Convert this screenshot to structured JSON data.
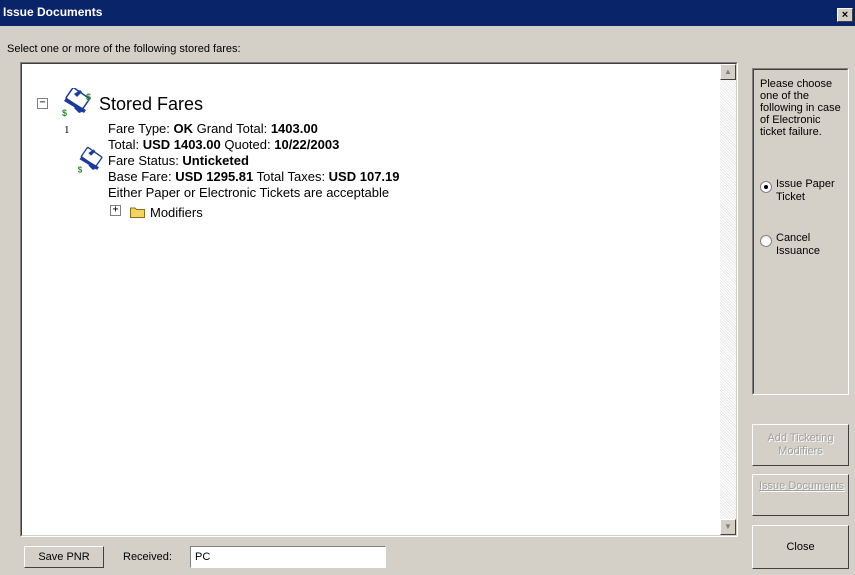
{
  "window": {
    "title": "Issue Documents",
    "close_glyph": "×"
  },
  "prompt_text": "Select one or more of the following stored fares:",
  "tree": {
    "root_expander": "−",
    "root_label": "Stored Fares",
    "root_icon": "fare-ticket-icon",
    "fare": {
      "number": "1",
      "icon": "fare-ticket-icon",
      "fare_type_label": "Fare Type: ",
      "fare_type": "OK",
      "grand_total_label": " Grand Total: ",
      "grand_total": "1403.00",
      "total_label": "Total: ",
      "total": "USD 1403.00",
      "quoted_label": " Quoted: ",
      "quoted": "10/22/2003",
      "status_label": "Fare Status: ",
      "status": "Unticketed",
      "base_fare_label": "Base Fare: ",
      "base_fare": "USD 1295.81",
      "total_taxes_label": " Total Taxes: ",
      "total_taxes": "USD 107.19",
      "note": "Either Paper or Electronic Tickets are acceptable",
      "modifiers_expander": "+",
      "modifiers_label": "Modifiers",
      "modifiers_icon": "folder-icon"
    }
  },
  "sidebar": {
    "message": "Please choose one of the following in case of Electronic ticket failure.",
    "options": [
      {
        "label": "Issue Paper Ticket",
        "checked": true
      },
      {
        "label": "Cancel Issuance",
        "checked": false
      }
    ],
    "add_ticketing_modifiers": "Add Ticketing Modifiers",
    "issue_documents": "Issue Documents",
    "close": "Close"
  },
  "footer": {
    "save_pnr": "Save PNR",
    "received_label": "Received:",
    "received_value": "PC"
  },
  "colors": {
    "title_bar": "#0a246a",
    "face": "#d4d0c8",
    "fare_icon_blue": "#1a3aa0",
    "fare_icon_green": "#2a8a2a",
    "folder_yellow": "#f4d35e"
  }
}
